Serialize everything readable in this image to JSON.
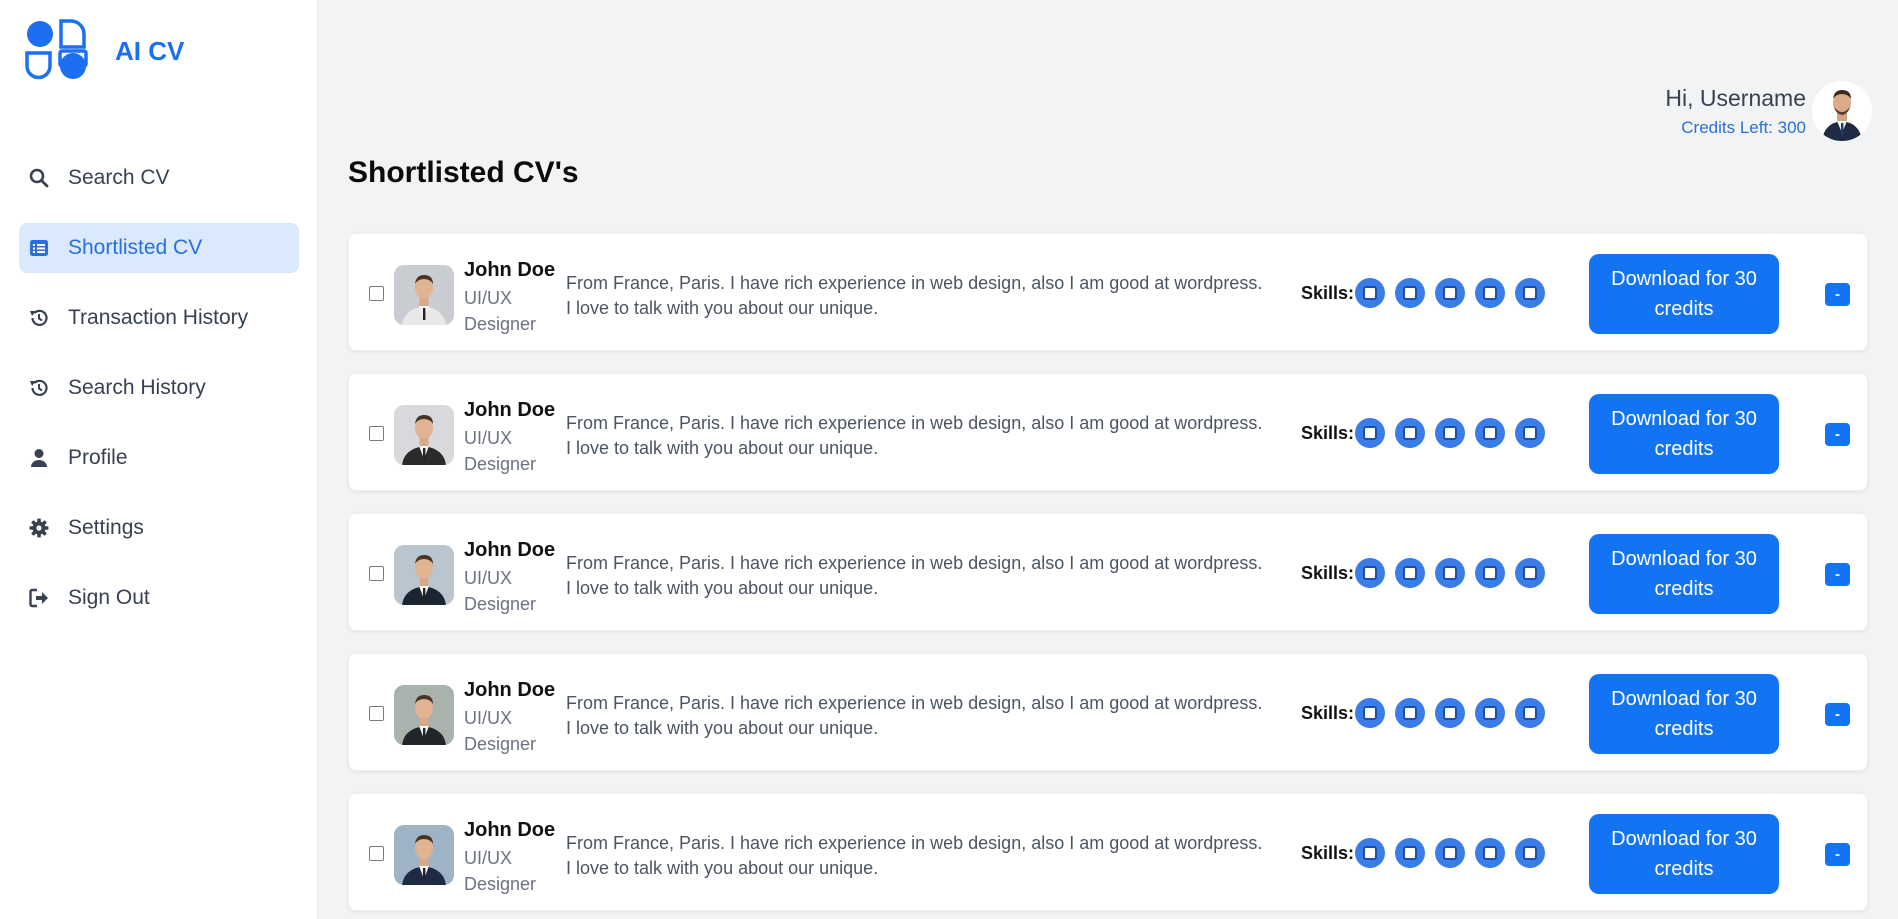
{
  "brand": {
    "name": "AI CV"
  },
  "sidebar": {
    "items": [
      {
        "label": "Search CV",
        "icon": "search-icon",
        "active": false
      },
      {
        "label": "Shortlisted CV",
        "icon": "list-icon",
        "active": true
      },
      {
        "label": "Transaction History",
        "icon": "history-icon",
        "active": false
      },
      {
        "label": "Search History",
        "icon": "history-icon",
        "active": false
      },
      {
        "label": "Profile",
        "icon": "user-icon",
        "active": false
      },
      {
        "label": "Settings",
        "icon": "gear-icon",
        "active": false
      },
      {
        "label": "Sign Out",
        "icon": "sign-out-icon",
        "active": false
      }
    ]
  },
  "header": {
    "greeting": "Hi, Username",
    "credits": "Credits Left: 300"
  },
  "page": {
    "title": "Shortlisted CV's"
  },
  "candidates": [
    {
      "name": "John Doe",
      "role": "UI/UX Designer",
      "description": "From France, Paris. I have rich experience in web design, also I am good at wordpress. I love to talk with you about our unique.",
      "skills_label": "Skills:",
      "download_label": "Download for 30 credits",
      "remove_label": "-",
      "photo_bg": "#c9cdd2",
      "suit": "#e8e8e8"
    },
    {
      "name": "John Doe",
      "role": "UI/UX Designer",
      "description": "From France, Paris. I have rich experience in web design, also I am good at wordpress. I love to talk with you about our unique.",
      "skills_label": "Skills:",
      "download_label": "Download for 30 credits",
      "remove_label": "-",
      "photo_bg": "#d7d9dc",
      "suit": "#2a2a2a"
    },
    {
      "name": "John Doe",
      "role": "UI/UX Designer",
      "description": "From France, Paris. I have rich experience in web design, also I am good at wordpress. I love to talk with you about our unique.",
      "skills_label": "Skills:",
      "download_label": "Download for 30 credits",
      "remove_label": "-",
      "photo_bg": "#b9c6cf",
      "suit": "#1d2533"
    },
    {
      "name": "John Doe",
      "role": "UI/UX Designer",
      "description": "From France, Paris. I have rich experience in web design, also I am good at wordpress. I love to talk with you about our unique.",
      "skills_label": "Skills:",
      "download_label": "Download for 30 credits",
      "remove_label": "-",
      "photo_bg": "#a9b3ad",
      "suit": "#22262b"
    },
    {
      "name": "John Doe",
      "role": "UI/UX Designer",
      "description": "From France, Paris. I have rich experience in web design, also I am good at wordpress. I love to talk with you about our unique.",
      "skills_label": "Skills:",
      "download_label": "Download for 30 credits",
      "remove_label": "-",
      "photo_bg": "#9fb3c6",
      "suit": "#1f2a44"
    }
  ],
  "colors": {
    "accent": "#1273f3",
    "active_bg": "#dbe9fd",
    "skill": "#3a7ce8"
  }
}
